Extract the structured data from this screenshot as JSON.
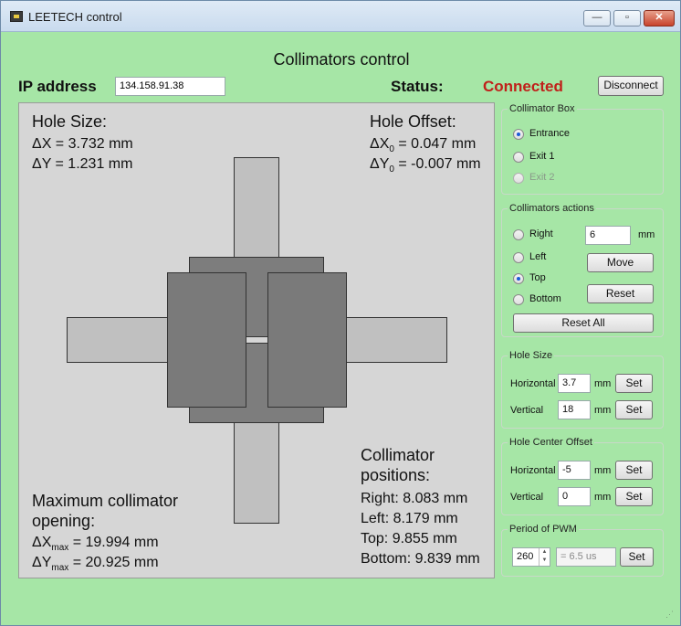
{
  "window": {
    "title": "LEETECH control",
    "minimize": "—",
    "maximize": "▫",
    "close": "✕"
  },
  "header": {
    "heading": "Collimators control",
    "ip_label": "IP address",
    "ip_value": "134.158.91.38",
    "status_label": "Status:",
    "status_value": "Connected",
    "disconnect_label": "Disconnect"
  },
  "canvas": {
    "hole_size_title": "Hole Size:",
    "hole_size_dx": "ΔX = 3.732 mm",
    "hole_size_dy": "ΔY = 1.231 mm",
    "hole_offset_title": "Hole Offset:",
    "hole_offset_dx_prefix": "ΔX",
    "hole_offset_dx_sub": "0",
    "hole_offset_dx_value": "= 0.047 mm",
    "hole_offset_dy_prefix": "ΔY",
    "hole_offset_dy_sub": "0",
    "hole_offset_dy_value": "= -0.007 mm",
    "max_title_line1": "Maximum collimator",
    "max_title_line2": "opening:",
    "max_dx_prefix": "ΔX",
    "max_dx_sub": "max",
    "max_dx_value": "= 19.994 mm",
    "max_dy_prefix": "ΔY",
    "max_dy_sub": "max",
    "max_dy_value": "= 20.925 mm",
    "positions_title_line1": "Collimator",
    "positions_title_line2": "positions:",
    "pos_right": "Right: 8.083 mm",
    "pos_left": "Left: 8.179 mm",
    "pos_top": "Top: 9.855 mm",
    "pos_bottom": "Bottom: 9.839 mm"
  },
  "collimator_box": {
    "title": "Collimator Box",
    "options": [
      "Entrance",
      "Exit 1",
      "Exit 2"
    ],
    "selected": "Entrance"
  },
  "collimators_actions": {
    "title": "Collimators actions",
    "options": [
      "Right",
      "Left",
      "Top",
      "Bottom"
    ],
    "selected": "Top",
    "step_value": "6",
    "step_unit": "mm",
    "move_label": "Move",
    "reset_label": "Reset",
    "reset_all_label": "Reset All"
  },
  "hole_size": {
    "title": "Hole Size",
    "horizontal_label": "Horizontal",
    "horizontal_value": "3.7",
    "vertical_label": "Vertical",
    "vertical_value": "18",
    "unit": "mm",
    "set_label": "Set"
  },
  "hole_center_offset": {
    "title": "Hole Center Offset",
    "horizontal_label": "Horizontal",
    "horizontal_value": "-5",
    "vertical_label": "Vertical",
    "vertical_value": "0",
    "unit": "mm",
    "set_label": "Set"
  },
  "pwm": {
    "title": "Period of PWM",
    "value": "260",
    "computed": "= 6.5 us",
    "set_label": "Set"
  },
  "colors": {
    "background": "#a6e6a6",
    "status_connected": "#c0201a",
    "radio_selected": "#1a5ad8"
  }
}
